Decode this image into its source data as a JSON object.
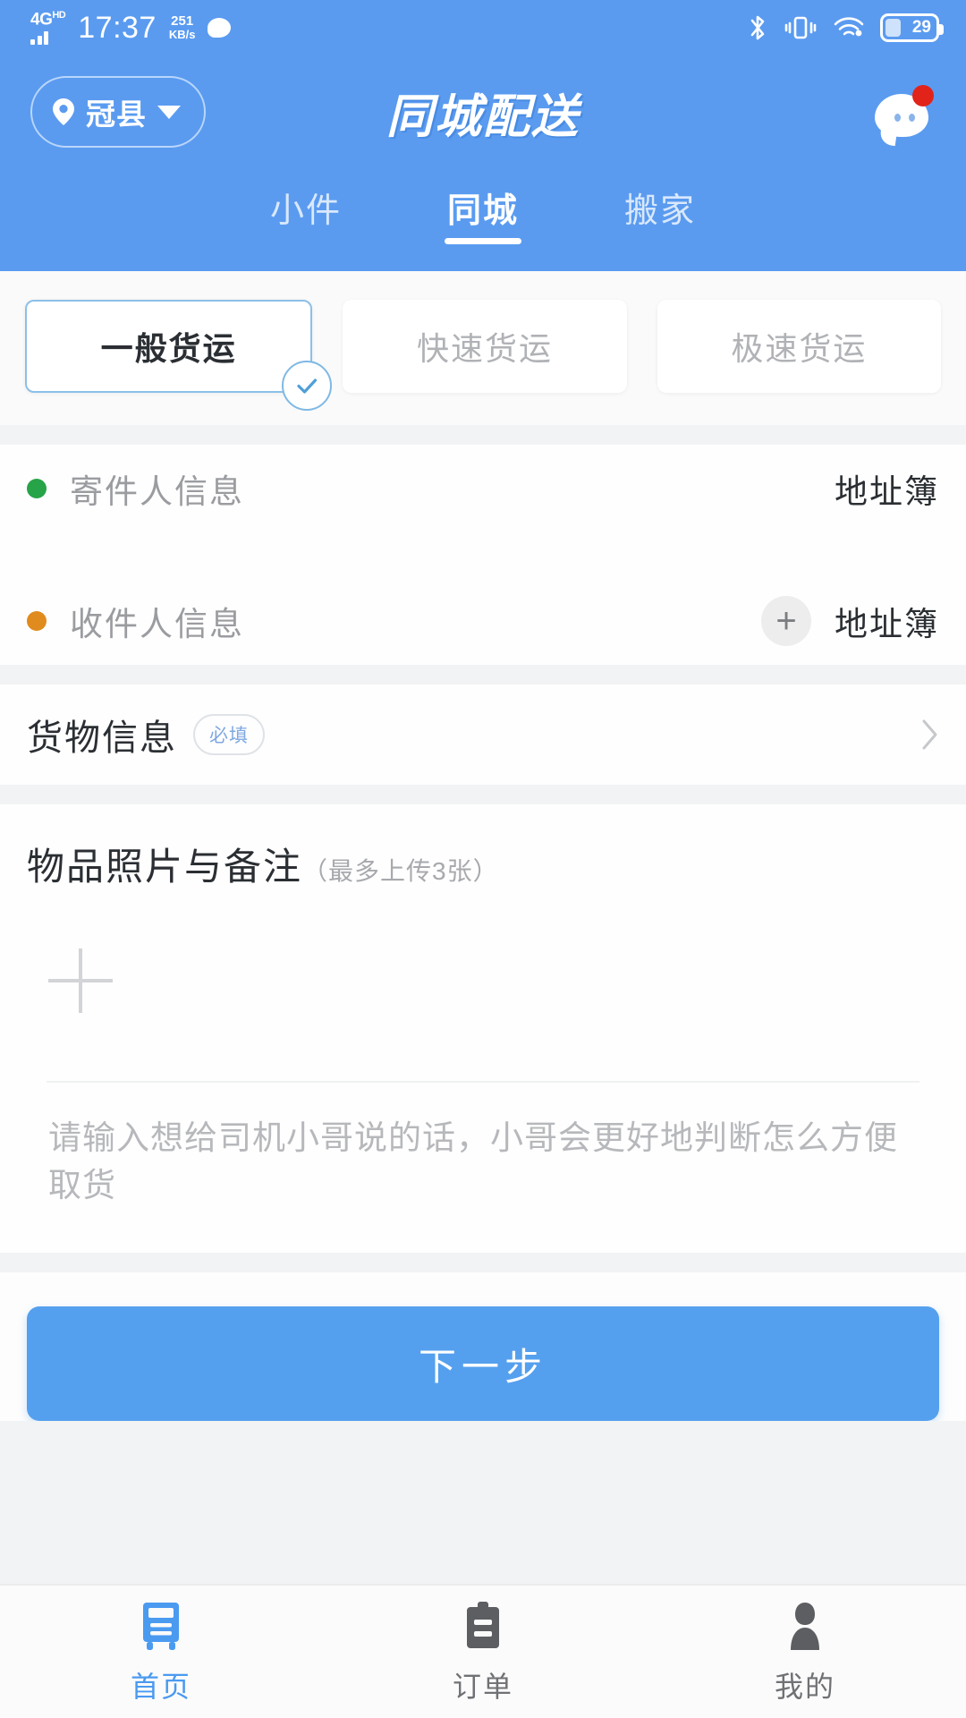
{
  "statusbar": {
    "network_type": "4G",
    "network_hd": "HD",
    "time": "17:37",
    "speed_value": "251",
    "speed_unit": "KB/s",
    "message_icon": "message-bubble-icon",
    "bluetooth_icon": "bluetooth-icon",
    "vibrate_icon": "vibrate-icon",
    "wifi_icon": "wifi-icon",
    "battery_level": "29"
  },
  "header": {
    "location": "冠县",
    "location_pin_icon": "location-pin-icon",
    "location_caret_icon": "chevron-down-icon",
    "title": "同城配送",
    "chat_icon": "chat-bubble-icon",
    "has_unread": true,
    "tabs": [
      {
        "label": "小件",
        "active": false
      },
      {
        "label": "同城",
        "active": true
      },
      {
        "label": "搬家",
        "active": false
      }
    ]
  },
  "service_types": [
    {
      "label": "一般货运",
      "selected": true
    },
    {
      "label": "快速货运",
      "selected": false
    },
    {
      "label": "极速货运",
      "selected": false
    }
  ],
  "contacts": {
    "sender": {
      "label": "寄件人信息",
      "dot_color": "#27a348",
      "addressbook_label": "地址簿",
      "has_add_button": false
    },
    "receiver": {
      "label": "收件人信息",
      "dot_color": "#e08b1e",
      "addressbook_label": "地址簿",
      "has_add_button": true,
      "add_label": "+"
    }
  },
  "goods": {
    "label": "货物信息",
    "required_badge": "必填",
    "chevron_icon": "chevron-right-icon"
  },
  "photo_remark": {
    "title": "物品照片与备注",
    "hint": "（最多上传3张）",
    "upload_icon": "plus-icon",
    "remark_placeholder": "请输入想给司机小哥说的话，小哥会更好地判断怎么方便取货"
  },
  "primary_action": {
    "label": "下一步"
  },
  "bottom_nav": [
    {
      "label": "首页",
      "icon": "home-icon",
      "active": true
    },
    {
      "label": "订单",
      "icon": "clipboard-icon",
      "active": false
    },
    {
      "label": "我的",
      "icon": "person-icon",
      "active": false
    }
  ],
  "colors": {
    "brand_blue": "#5a9bf0",
    "button_blue": "#55a0ee",
    "sender_green": "#27a348",
    "receiver_orange": "#e08b1e",
    "badge_red": "#e2231a"
  }
}
